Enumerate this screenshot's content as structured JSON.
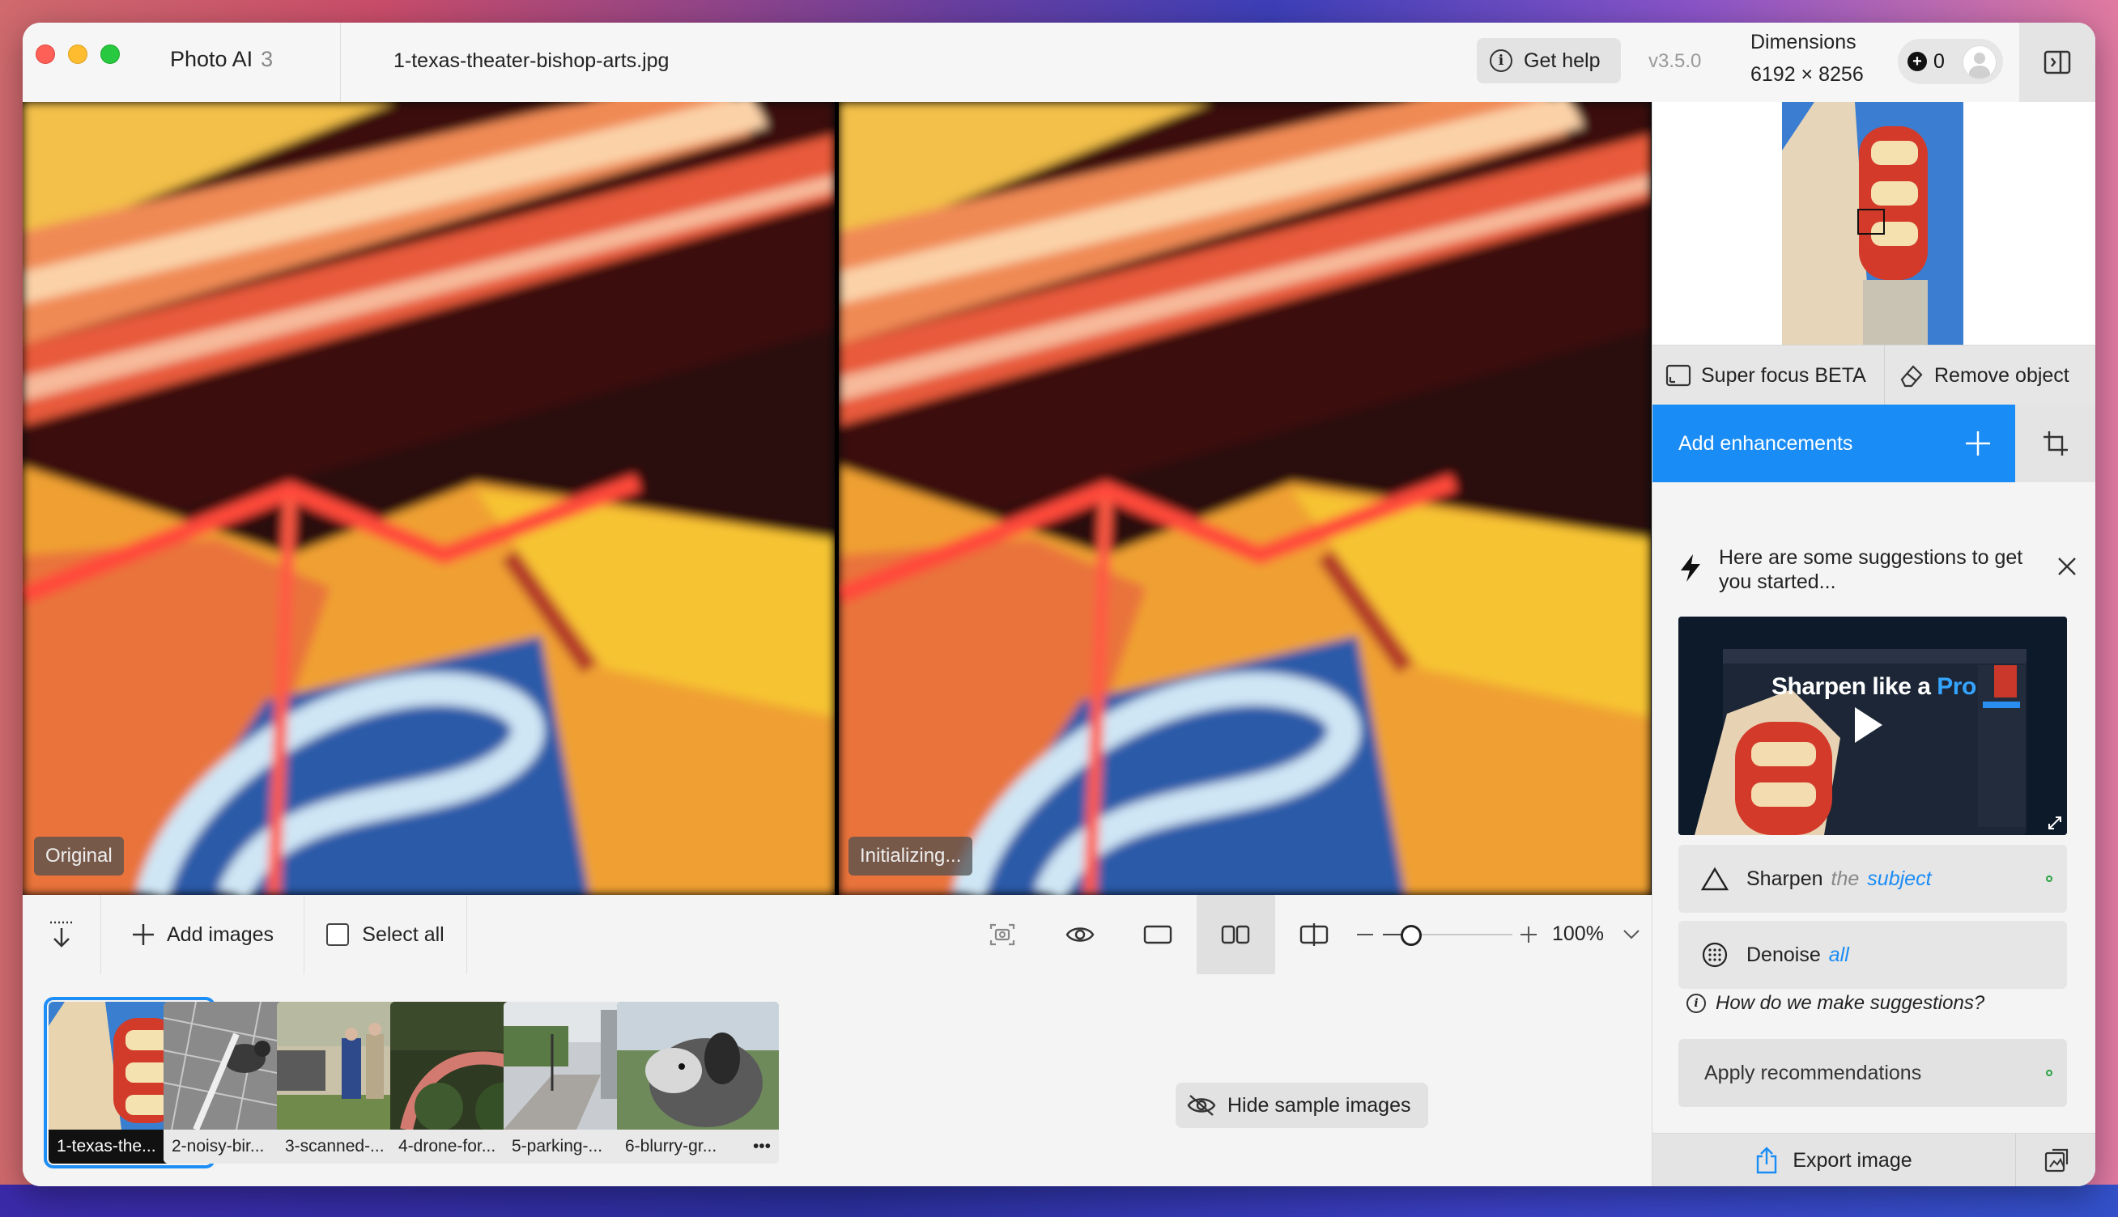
{
  "app": {
    "title": "Photo AI",
    "count": "3",
    "file_name": "1-texas-theater-bishop-arts.jpg",
    "version": "v3.5.0"
  },
  "header": {
    "help_label": "Get help",
    "dimensions_label": "Dimensions",
    "dimensions_value": "6192 × 8256",
    "credits": "0"
  },
  "preview": {
    "left_label": "Original",
    "right_label": "Initializing..."
  },
  "toolbar": {
    "add_images": "Add images",
    "select_all": "Select all",
    "zoom": "100%",
    "zoom_level": 0.2
  },
  "thumbnails": [
    {
      "label": "1-texas-the...",
      "selected": true
    },
    {
      "label": "2-noisy-bir..."
    },
    {
      "label": "3-scanned-..."
    },
    {
      "label": "4-drone-for..."
    },
    {
      "label": "5-parking-..."
    },
    {
      "label": "6-blurry-gr..."
    }
  ],
  "thumbnail_menu": "•••",
  "hide_samples": "Hide sample images",
  "panel": {
    "super_focus": "Super focus BETA",
    "remove_object": "Remove object",
    "add_enhancements": "Add enhancements",
    "suggestion_head": "Here are some suggestions to get you started...",
    "video_title_main": "Sharpen like a ",
    "video_title_pro": "Pro",
    "recs": [
      {
        "verb": "Sharpen",
        "the": "the",
        "target": "subject"
      },
      {
        "verb": "Denoise",
        "target": "all"
      }
    ],
    "how": "How do we make suggestions?",
    "apply": "Apply recommendations",
    "export": "Export image"
  },
  "colors": {
    "accent": "#1a8cf5",
    "status_green": "#2aa344"
  }
}
